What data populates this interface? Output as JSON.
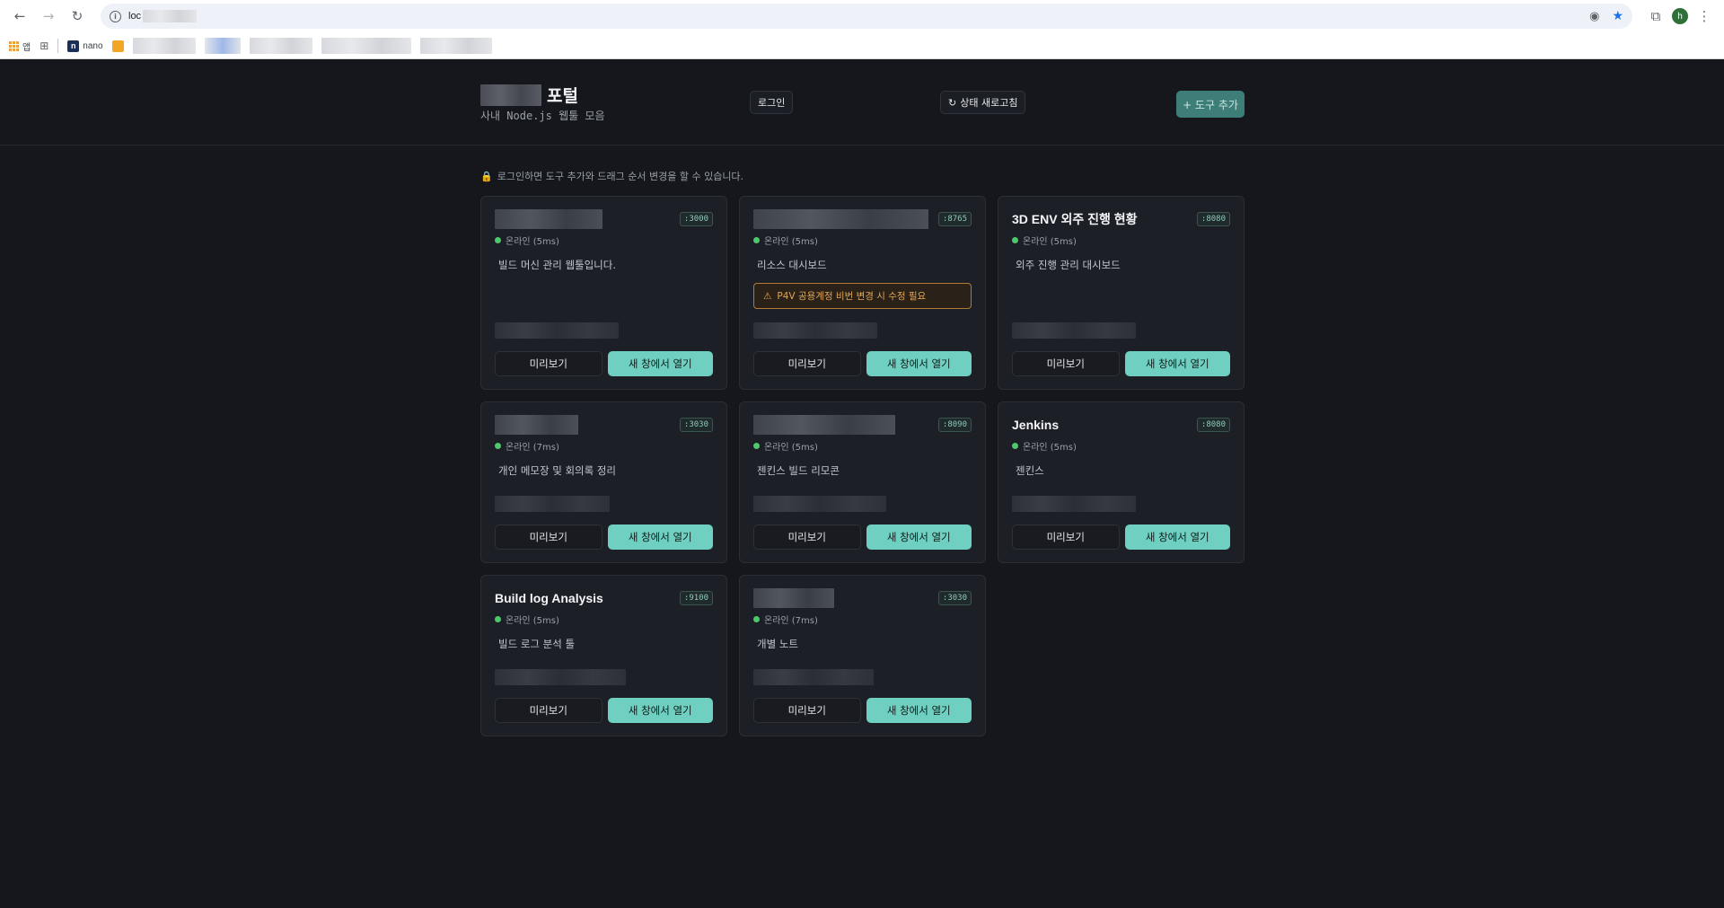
{
  "browser": {
    "url": "loc",
    "bookmarks": {
      "apps_label": "앱",
      "nano_label": "nano"
    },
    "profile_initial": "h"
  },
  "header": {
    "title_suffix": "포털",
    "subtitle": "사내 Node.js 웹툴 모음",
    "login_label": "로그인",
    "refresh_label": "상태 새로고침",
    "add_label": "+ 도구 추가"
  },
  "notice": "로그인하면 도구 추가와 드래그 순서 변경을 할 수 있습니다.",
  "buttons": {
    "preview": "미리보기",
    "open": "새 창에서 열기"
  },
  "tools": [
    {
      "title": "",
      "port": ":3000",
      "status": "온라인 (5ms)",
      "desc": "빌드 머신 관리 웹툴입니다.",
      "warning": ""
    },
    {
      "title": "",
      "port": ":8765",
      "status": "온라인 (5ms)",
      "desc": "리소스 대시보드",
      "warning": "P4V 공용계정 비번 변경 시 수정 필요"
    },
    {
      "title": "3D ENV 외주 진행 현황",
      "port": ":8080",
      "status": "온라인 (5ms)",
      "desc": "외주 진행 관리 대시보드",
      "warning": ""
    },
    {
      "title": "",
      "port": ":3030",
      "status": "온라인 (7ms)",
      "desc": "개인 메모장 및 회의록 정리",
      "warning": ""
    },
    {
      "title": "",
      "port": ":8090",
      "status": "온라인 (5ms)",
      "desc": "젠킨스 빌드 리모콘",
      "warning": ""
    },
    {
      "title": "Jenkins",
      "port": ":8080",
      "status": "온라인 (5ms)",
      "desc": "젠킨스",
      "warning": ""
    },
    {
      "title": "Build log Analysis",
      "port": ":9100",
      "status": "온라인 (5ms)",
      "desc": "빌드 로그 분석 툴",
      "warning": ""
    },
    {
      "title": "",
      "port": ":3030",
      "status": "온라인 (7ms)",
      "desc": "개별 노트",
      "warning": ""
    }
  ]
}
